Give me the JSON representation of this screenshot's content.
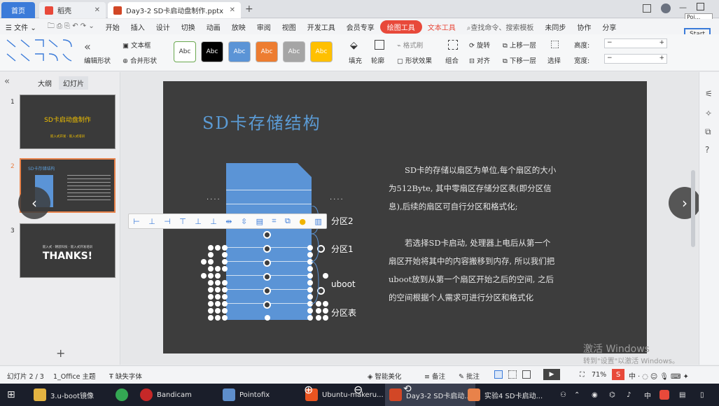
{
  "tabs": {
    "home": "首页",
    "doc1": "稻壳",
    "doc2": "Day3-2 SD卡启动盘制作.pptx",
    "add": "+"
  },
  "menu": {
    "file": "文件",
    "items": [
      "开始",
      "插入",
      "设计",
      "切换",
      "动画",
      "放映",
      "审阅",
      "视图",
      "开发工具",
      "会员专享"
    ],
    "drawing_tools": "绘图工具",
    "text_tools": "文本工具",
    "search_placeholder": "查找命令、搜索模板",
    "sync": "未同步",
    "collab": "协作",
    "share": "分享"
  },
  "ribbon": {
    "edit_shape": "编辑形状",
    "textbox": "文本框",
    "merge_shape": "合并形状",
    "style_samples": [
      "Abc",
      "Abc",
      "Abc",
      "Abc",
      "Abc",
      "Abc"
    ],
    "fill": "填充",
    "outline": "轮廓",
    "format_brush": "格式刷",
    "shape_effect": "形状效果",
    "group": "组合",
    "rotate": "旋转",
    "align": "对齐",
    "bring_forward": "上移一层",
    "send_backward": "下移一层",
    "select": "选择",
    "height_label": "高度:",
    "width_label": "宽度:"
  },
  "window": {
    "popup_title": "Poi...",
    "start_button": "Start"
  },
  "left_panel": {
    "outline_tab": "大纲",
    "slides_tab": "幻灯片",
    "slides": [
      {
        "num": "1",
        "title": "SD卡启动盘制作",
        "sub": "嵌入式开发 · 嵌入式培训"
      },
      {
        "num": "2",
        "title": "SD卡存储结构"
      },
      {
        "num": "3",
        "title": "THANKS!",
        "sub": "嵌入式 · 朝思科技 · 嵌入式开发培训"
      }
    ],
    "add": "+"
  },
  "slide": {
    "title": "SD卡存储结构",
    "dots_left": "····",
    "dots_right": "····",
    "label_part2": "分区2",
    "label_part1": "分区1",
    "label_uboot": "uboot",
    "label_table": "分区表",
    "para1": "SD卡的存储以扇区为单位,每个扇区的大小为512Byte, 其中零扇区存储分区表(即分区信息),后续的扇区可自行分区和格式化;",
    "para2": "若选择SD卡启动, 处理器上电后从第一个扇区开始将其中的内容搬移到内存, 所以我们把uboot放到从第一个扇区开始之后的空间, 之后的空间根据个人需求可进行分区和格式化"
  },
  "watermark": {
    "line1": "激活 Windows",
    "line2": "转到\"设置\"以激活 Windows。"
  },
  "status": {
    "slide_index": "幻灯片 2 / 3",
    "theme": "1_Office 主题",
    "missing_font": "缺失字体",
    "beautify": "智能美化",
    "notes": "备注",
    "comment": "批注",
    "zoom": "71%"
  },
  "taskbar": {
    "items": [
      "3.u-boot镜像",
      "Bandicam",
      "Pointofix",
      "Ubuntu-makeru...",
      "Day3-2 SD卡启动...",
      "实验4 SD卡启动..."
    ],
    "ime": "中"
  },
  "colors": {
    "accent": "#e8493a",
    "blue": "#3b7bd9",
    "slide_bg": "#3d3d3d",
    "card": "#5b94d6",
    "title": "#5b9bd5"
  }
}
